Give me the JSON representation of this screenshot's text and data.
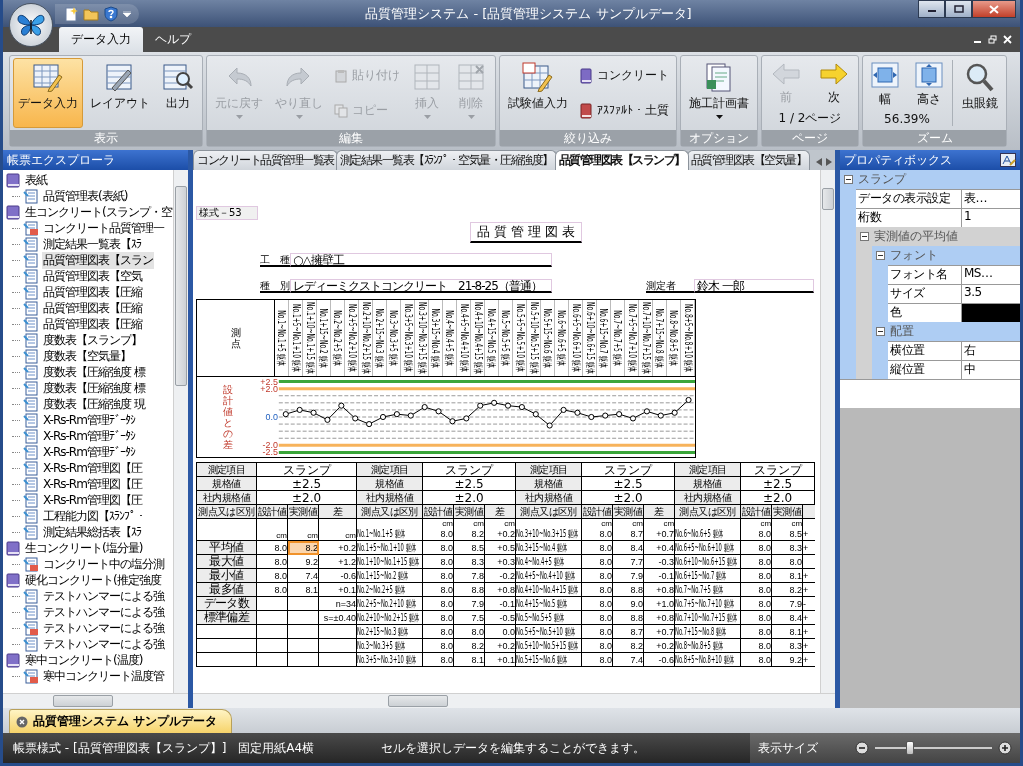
{
  "window": {
    "title": "品質管理システム - [品質管理システム サンプルデータ]"
  },
  "ribbon": {
    "tabs": [
      {
        "label": "データ入力",
        "selected": true
      },
      {
        "label": "ヘルプ",
        "selected": false
      }
    ],
    "groups": [
      {
        "title": "表示",
        "items": [
          {
            "kind": "large",
            "label": "データ入力",
            "selected": true,
            "disabled": false,
            "menu": false
          },
          {
            "kind": "large",
            "label": "レイアウト",
            "selected": false,
            "disabled": false,
            "menu": false
          },
          {
            "kind": "large",
            "label": "出力",
            "selected": false,
            "disabled": false,
            "menu": false
          }
        ]
      },
      {
        "title": "編集",
        "items": [
          {
            "kind": "large",
            "label": "元に戻す",
            "selected": false,
            "disabled": true,
            "menu": true
          },
          {
            "kind": "large",
            "label": "やり直し",
            "selected": false,
            "disabled": true,
            "menu": true
          },
          {
            "kind": "small",
            "label": "貼り付け",
            "selected": false,
            "disabled": true,
            "menu": false
          },
          {
            "kind": "small",
            "label": "コピー",
            "selected": false,
            "disabled": true,
            "menu": false
          },
          {
            "kind": "large",
            "label": "挿入",
            "selected": false,
            "disabled": true,
            "menu": true
          },
          {
            "kind": "large",
            "label": "削除",
            "selected": false,
            "disabled": true,
            "menu": true
          }
        ]
      },
      {
        "title": "絞り込み",
        "items": [
          {
            "kind": "large",
            "label": "試験値入力",
            "selected": false,
            "disabled": false,
            "menu": false
          },
          {
            "kind": "small",
            "label": "コンクリート",
            "selected": false,
            "disabled": false,
            "menu": false
          },
          {
            "kind": "small",
            "label": "ｱｽﾌｧﾙﾄ・土質",
            "selected": false,
            "disabled": false,
            "menu": false
          }
        ]
      },
      {
        "title": "オプション",
        "items": [
          {
            "kind": "large",
            "label": "施工計画書",
            "selected": false,
            "disabled": false,
            "menu": true
          }
        ]
      },
      {
        "title": "ページ",
        "caption": "1 / 2ページ",
        "items": [
          {
            "kind": "compact",
            "label": "前",
            "selected": false,
            "disabled": true,
            "menu": false
          },
          {
            "kind": "compact",
            "label": "次",
            "selected": false,
            "disabled": false,
            "menu": false
          }
        ]
      },
      {
        "title": "ズーム",
        "caption": "56.39%",
        "items": [
          {
            "kind": "compact",
            "label": "幅",
            "selected": false,
            "disabled": false,
            "menu": false
          },
          {
            "kind": "compact",
            "label": "高さ",
            "selected": false,
            "disabled": false,
            "menu": false
          },
          {
            "kind": "large",
            "label": "虫眼鏡",
            "selected": false,
            "disabled": false,
            "menu": false
          }
        ]
      }
    ]
  },
  "explorer": {
    "title": "帳票エクスプローラ",
    "items": [
      {
        "label": "表紙",
        "selected": false,
        "children": [
          {
            "label": "品質管理表(表紙)",
            "kind": "doc",
            "selected": false
          }
        ]
      },
      {
        "label": "生コンクリート(スランプ・空",
        "selected": false,
        "children": [
          {
            "label": "コンクリート品質管理一",
            "kind": "pdf",
            "selected": false
          },
          {
            "label": "測定結果一覧表【ｽﾗ",
            "kind": "doc",
            "selected": false
          },
          {
            "label": "品質管理図表【スラン",
            "kind": "doc",
            "selected": true
          },
          {
            "label": "品質管理図表【空気",
            "kind": "doc",
            "selected": false
          },
          {
            "label": "品質管理図表【圧縮",
            "kind": "doc",
            "selected": false
          },
          {
            "label": "品質管理図表【圧縮",
            "kind": "doc",
            "selected": false
          },
          {
            "label": "品質管理図表【圧縮",
            "kind": "doc",
            "selected": false
          },
          {
            "label": "度数表【スランプ】",
            "kind": "doc",
            "selected": false
          },
          {
            "label": "度数表【空気量】",
            "kind": "doc",
            "selected": false
          },
          {
            "label": "度数表【圧縮強度 標",
            "kind": "doc",
            "selected": false
          },
          {
            "label": "度数表【圧縮強度 標",
            "kind": "doc",
            "selected": false
          },
          {
            "label": "度数表【圧縮強度 現",
            "kind": "doc",
            "selected": false
          },
          {
            "label": "X-Rs-Rm管理ﾃﾞｰﾀｼ",
            "kind": "doc",
            "selected": false
          },
          {
            "label": "X-Rs-Rm管理ﾃﾞｰﾀｼ",
            "kind": "doc",
            "selected": false
          },
          {
            "label": "X-Rs-Rm管理ﾃﾞｰﾀｼ",
            "kind": "doc",
            "selected": false
          },
          {
            "label": "X-Rs-Rm管理図【圧",
            "kind": "doc",
            "selected": false
          },
          {
            "label": "X-Rs-Rm管理図【圧",
            "kind": "doc",
            "selected": false
          },
          {
            "label": "X-Rs-Rm管理図【圧",
            "kind": "doc",
            "selected": false
          },
          {
            "label": "工程能力図【ｽﾗﾝﾌﾟ・",
            "kind": "doc",
            "selected": false
          },
          {
            "label": "測定結果総括表【ｽﾗ",
            "kind": "doc",
            "selected": false
          }
        ]
      },
      {
        "label": "生コンクリート(塩分量)",
        "selected": false,
        "children": [
          {
            "label": "コンクリート中の塩分測",
            "kind": "pdf",
            "selected": false
          }
        ]
      },
      {
        "label": "硬化コンクリート(推定強度",
        "selected": false,
        "children": [
          {
            "label": "テストハンマーによる強",
            "kind": "doc",
            "selected": false
          },
          {
            "label": "テストハンマーによる強",
            "kind": "doc",
            "selected": false
          },
          {
            "label": "テストハンマーによる強",
            "kind": "pdf",
            "selected": false
          },
          {
            "label": "テストハンマーによる強",
            "kind": "doc",
            "selected": false
          }
        ]
      },
      {
        "label": "寒中コンクリート(温度)",
        "selected": false,
        "children": [
          {
            "label": "寒中コンクリート温度管",
            "kind": "pdf",
            "selected": false
          }
        ]
      }
    ]
  },
  "doc_tabs": [
    {
      "label": "コンクリート品質管理一覧表",
      "selected": false
    },
    {
      "label": "測定結果一覧表【ｽﾗﾝﾌﾟ・空気量・圧縮強度】",
      "selected": false
    },
    {
      "label": "品質管理図表【スランプ】",
      "selected": true
    },
    {
      "label": "品質管理図表【空気量】",
      "selected": false
    }
  ],
  "document": {
    "form_no": "様式－53",
    "title": "品 質 管 理 図 表",
    "fields": [
      {
        "label": "工　種",
        "value": "○△擁壁工"
      },
      {
        "label": "種　別",
        "value": "レディーミクストコンクリート　21-8-25（普通）"
      }
    ],
    "inspector": {
      "label": "測定者",
      "value": "鈴木 一郎"
    },
    "point_label": "測点",
    "chart_data": {
      "type": "line",
      "ylabel": "設計値との差",
      "ylim": [
        -2.8,
        2.8
      ],
      "grid": true,
      "yticks": [
        {
          "value": 2.5,
          "label": "+2.5"
        },
        {
          "value": 2.0,
          "label": "+2.0"
        },
        {
          "value": 0,
          "label": "0.0"
        },
        {
          "value": -2.0,
          "label": "-2.0"
        },
        {
          "value": -2.5,
          "label": "-2.5"
        }
      ],
      "categories": [
        "No.1~No.1+5 躯体",
        "No.1+5~No.1+10 躯体",
        "No.1+10~No.1+15 躯体",
        "No.1+15~No.2 躯体",
        "No.2~No.2+5 躯体",
        "No.2+5~No.2+10 躯体",
        "No.2+10~No.2+15 躯体",
        "No.2+15~No.3 躯体",
        "No.3~No.3+5 躯体",
        "No.3+5~No.3+10 躯体",
        "No.3+10~No.3+15 躯体",
        "No.3+15~No.4 躯体",
        "No.4~No.4+5 躯体",
        "No.4+5~No.4+10 躯体",
        "No.4+10~No.4+15 躯体",
        "No.4+15~No.5 躯体",
        "No.5~No.5+5 躯体",
        "No.5+5~No.5+10 躯体",
        "No.5+10~No.5+15 躯体",
        "No.5+15~No.6 躯体",
        "No.6~No.6+5 躯体",
        "No.6+5~No.6+10 躯体",
        "No.6+10~No.6+15 躯体",
        "No.6+15~No.7 躯体",
        "No.7~No.7+5 躯体",
        "No.7+5~No.7+10 躯体",
        "No.7+10~No.7+15 躯体",
        "No.7+15~No.8 躯体",
        "No.8~No.8+5 躯体",
        "No.8+5~No.8+10 躯体"
      ],
      "series": [
        {
          "color": "#000000",
          "marker": "o",
          "values": [
            0.2,
            0.5,
            0.3,
            -0.2,
            0.8,
            -0.1,
            -0.5,
            0.0,
            0.2,
            0.1,
            0.7,
            0.4,
            -0.3,
            -0.1,
            0.8,
            1.0,
            0.8,
            0.7,
            0.2,
            -0.6,
            0.5,
            0.3,
            0.0,
            0.1,
            0.2,
            -0.1,
            0.4,
            0.1,
            0.3,
            1.2
          ]
        }
      ]
    }
  },
  "table": {
    "blocks": [
      {
        "head": [
          {
            "label": "測定項目",
            "value": "スランプ"
          },
          {
            "label": "規格値",
            "value": "±2.5"
          },
          {
            "label": "社内規格値",
            "value": "±2.0"
          }
        ],
        "columns": [
          "測点又は区別",
          "設計値",
          "実測値",
          "差"
        ],
        "units": [
          "cm",
          "cm",
          "cm"
        ],
        "rows": [
          {
            "selected": false
          },
          {
            "label": "平均値",
            "design": "8.0",
            "measured": "8.2",
            "diff": "+0.2",
            "selected": true
          },
          {
            "label": "最大値",
            "design": "8.0",
            "measured": "9.2",
            "diff": "+1.2",
            "selected": false
          },
          {
            "label": "最小値",
            "design": "8.0",
            "measured": "7.4",
            "diff": "-0.6",
            "selected": false
          },
          {
            "label": "最多値",
            "design": "8.0",
            "measured": "8.1",
            "diff": "+0.1",
            "selected": false
          },
          {
            "label": "データ数",
            "diff": "n=34",
            "selected": false
          },
          {
            "label": "標準偏差",
            "diff": "s=±0.40",
            "selected": false
          },
          {
            "selected": false
          },
          {
            "selected": false
          },
          {
            "selected": false
          }
        ]
      },
      {
        "head": [
          {
            "label": "測定項目",
            "value": "スランプ"
          },
          {
            "label": "規格値",
            "value": "±2.5"
          },
          {
            "label": "社内規格値",
            "value": "±2.0"
          }
        ],
        "columns": [
          "測点又は区別",
          "設計値",
          "実測値",
          "差"
        ],
        "units": [
          "cm",
          "cm",
          "cm"
        ],
        "rows": [
          {
            "label": "No.1~No.1+5 躯体",
            "design": "8.0",
            "measured": "8.2",
            "diff": "+0.2",
            "selected": false
          },
          {
            "label": "No.1+5~No.1+10 躯体",
            "design": "8.0",
            "measured": "8.5",
            "diff": "+0.5",
            "selected": false
          },
          {
            "label": "No.1+10~No.1+15 躯体",
            "design": "8.0",
            "measured": "8.3",
            "diff": "+0.3",
            "selected": false
          },
          {
            "label": "No.1+15~No.2 躯体",
            "design": "8.0",
            "measured": "7.8",
            "diff": "-0.2",
            "selected": false
          },
          {
            "label": "No.2~No.2+5 躯体",
            "design": "8.0",
            "measured": "8.8",
            "diff": "+0.8",
            "selected": false
          },
          {
            "label": "No.2+5~No.2+10 躯体",
            "design": "8.0",
            "measured": "7.9",
            "diff": "-0.1",
            "selected": false
          },
          {
            "label": "No.2+10~No.2+15 躯体",
            "design": "8.0",
            "measured": "7.5",
            "diff": "-0.5",
            "selected": false
          },
          {
            "label": "No.2+15~No.3 躯体",
            "design": "8.0",
            "measured": "8.0",
            "diff": "0.0",
            "selected": false
          },
          {
            "label": "No.3~No.3+5 躯体",
            "design": "8.0",
            "measured": "8.2",
            "diff": "+0.2",
            "selected": false
          },
          {
            "label": "No.3+5~No.3+10 躯体",
            "design": "8.0",
            "measured": "8.1",
            "diff": "+0.1",
            "selected": false
          }
        ]
      },
      {
        "head": [
          {
            "label": "測定項目",
            "value": "スランプ"
          },
          {
            "label": "規格値",
            "value": "±2.5"
          },
          {
            "label": "社内規格値",
            "value": "±2.0"
          }
        ],
        "columns": [
          "測点又は区別",
          "設計値",
          "実測値",
          "差"
        ],
        "units": [
          "cm",
          "cm",
          "cm"
        ],
        "rows": [
          {
            "label": "No.3+10~No.3+15 躯体",
            "design": "8.0",
            "measured": "8.7",
            "diff": "+0.7",
            "selected": false
          },
          {
            "label": "No.3+15~No.4 躯体",
            "design": "8.0",
            "measured": "8.4",
            "diff": "+0.4",
            "selected": false
          },
          {
            "label": "No.4~No.4+5 躯体",
            "design": "8.0",
            "measured": "7.7",
            "diff": "-0.3",
            "selected": false
          },
          {
            "label": "No.4+5~No.4+10 躯体",
            "design": "8.0",
            "measured": "7.9",
            "diff": "-0.1",
            "selected": false
          },
          {
            "label": "No.4+10~No.4+15 躯体",
            "design": "8.0",
            "measured": "8.8",
            "diff": "+0.8",
            "selected": false
          },
          {
            "label": "No.4+15~No.5 躯体",
            "design": "8.0",
            "measured": "9.0",
            "diff": "+1.0",
            "selected": false
          },
          {
            "label": "No.5~No.5+5 躯体",
            "design": "8.0",
            "measured": "8.8",
            "diff": "+0.8",
            "selected": false
          },
          {
            "label": "No.5+5~No.5+10 躯体",
            "design": "8.0",
            "measured": "8.7",
            "diff": "+0.7",
            "selected": false
          },
          {
            "label": "No.5+10~No.5+15 躯体",
            "design": "8.0",
            "measured": "8.2",
            "diff": "+0.2",
            "selected": false
          },
          {
            "label": "No.5+15~No.6 躯体",
            "design": "8.0",
            "measured": "7.4",
            "diff": "-0.6",
            "selected": false
          }
        ]
      },
      {
        "head": [
          {
            "label": "測定項目",
            "value": "スランプ"
          },
          {
            "label": "規格値",
            "value": "±2.5"
          },
          {
            "label": "社内規格値",
            "value": "±2.0"
          }
        ],
        "columns": [
          "測点又は区別",
          "設計値",
          "実測値"
        ],
        "units": [
          "cm",
          "cm"
        ],
        "rows": [
          {
            "label": "No.6~No.6+5 躯体",
            "design": "8.0",
            "measured": "8.5",
            "diff": "+",
            "selected": false
          },
          {
            "label": "No.6+5~No.6+10 躯体",
            "design": "8.0",
            "measured": "8.3",
            "diff": "+",
            "selected": false
          },
          {
            "label": "No.6+10~No.6+15 躯体",
            "design": "8.0",
            "measured": "8.0",
            "selected": false
          },
          {
            "label": "No.6+15~No.7 躯体",
            "design": "8.0",
            "measured": "8.1",
            "diff": "+",
            "selected": false
          },
          {
            "label": "No.7~No.7+5 躯体",
            "design": "8.0",
            "measured": "8.2",
            "diff": "+",
            "selected": false
          },
          {
            "label": "No.7+5~No.7+10 躯体",
            "design": "8.0",
            "measured": "7.9",
            "diff": "-",
            "selected": false
          },
          {
            "label": "No.7+10~No.7+15 躯体",
            "design": "8.0",
            "measured": "8.4",
            "diff": "+",
            "selected": false
          },
          {
            "label": "No.7+15~No.8 躯体",
            "design": "8.0",
            "measured": "8.1",
            "diff": "+",
            "selected": false
          },
          {
            "label": "No.8~No.8+5 躯体",
            "design": "8.0",
            "measured": "8.3",
            "diff": "+",
            "selected": false
          },
          {
            "label": "No.8+5~No.8+10 躯体",
            "design": "8.0",
            "measured": "9.2",
            "diff": "+",
            "selected": false
          }
        ]
      }
    ]
  },
  "properties": {
    "title": "プロパティボックス",
    "items": [
      {
        "kind": "category",
        "label": "スランプ",
        "expanded": true,
        "children": [
          {
            "kind": "property",
            "label": "データの表示設定",
            "value": "表…"
          },
          {
            "kind": "property",
            "label": "桁数",
            "value": "1"
          },
          {
            "kind": "category",
            "label": "実測値の平均値",
            "expanded": true,
            "children": [
              {
                "kind": "category",
                "label": "フォント",
                "expanded": true,
                "children": [
                  {
                    "kind": "property",
                    "label": "フォント名",
                    "value": "MS…"
                  },
                  {
                    "kind": "property",
                    "label": "サイズ",
                    "value": "3.5"
                  },
                  {
                    "kind": "color",
                    "label": "色",
                    "color": "#000000"
                  }
                ]
              },
              {
                "kind": "category",
                "label": "配置",
                "expanded": true,
                "children": [
                  {
                    "kind": "property",
                    "label": "横位置",
                    "value": "右"
                  },
                  {
                    "kind": "property",
                    "label": "縦位置",
                    "value": "中"
                  }
                ]
              }
            ]
          }
        ]
      }
    ]
  },
  "document_tab": {
    "label": "品質管理システム サンプルデータ"
  },
  "status_bar": {
    "form": "帳票様式 - [品質管理図表【スランプ】]　固定用紙A4横",
    "message": "セルを選択しデータを編集することができます。",
    "zoom_label": "表示サイズ",
    "zoom": {
      "level": 0.3
    }
  }
}
